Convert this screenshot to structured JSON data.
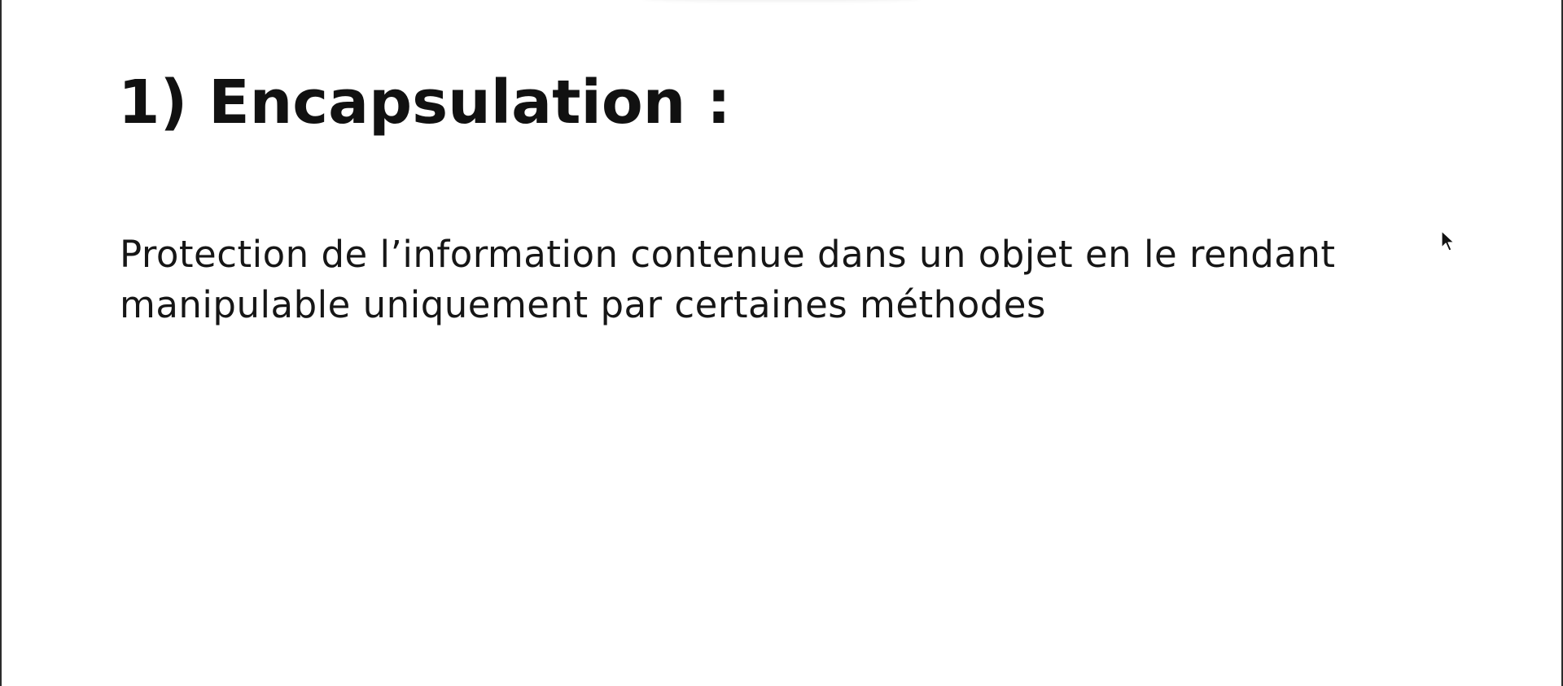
{
  "slide": {
    "title": "1) Encapsulation :",
    "body": "Protection de l’information contenue dans un objet en le rendant manipulable uniquement par certaines méthodes"
  },
  "colors": {
    "background": "#ffffff",
    "text": "#111111",
    "frame_edge": "#2b2b2b"
  },
  "icons": {
    "cursor": "mouse-pointer-icon"
  }
}
